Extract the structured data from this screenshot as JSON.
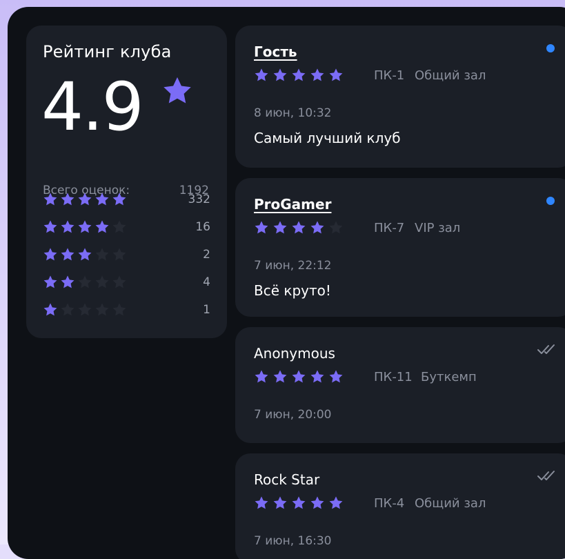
{
  "summary": {
    "title": "Рейтинг клуба",
    "score": "4.9",
    "total_label": "Всего оценок:",
    "total_value": "1192",
    "distribution": [
      {
        "stars": 5,
        "count": "332"
      },
      {
        "stars": 4,
        "count": "16"
      },
      {
        "stars": 3,
        "count": "2"
      },
      {
        "stars": 2,
        "count": "4"
      },
      {
        "stars": 1,
        "count": "1"
      }
    ]
  },
  "reviews": [
    {
      "name": "Гость",
      "underlined": true,
      "rating": 5,
      "pc": "ПК-1",
      "hall": "Общий зал",
      "date": "8 июн, 10:32",
      "text": "Самый лучший клуб",
      "status": "unread"
    },
    {
      "name": "ProGamer",
      "underlined": true,
      "rating": 4,
      "pc": "ПК-7",
      "hall": "VIP зал",
      "date": "7 июн, 22:12",
      "text": "Всё круто!",
      "status": "unread"
    },
    {
      "name": "Anonymous",
      "underlined": false,
      "rating": 5,
      "pc": "ПК-11",
      "hall": "Буткемп",
      "date": "7 июн, 20:00",
      "text": "",
      "status": "read"
    },
    {
      "name": "Rock Star",
      "underlined": false,
      "rating": 5,
      "pc": "ПК-4",
      "hall": "Общий зал",
      "date": "7 июн, 16:30",
      "text": "",
      "status": "read"
    }
  ],
  "colors": {
    "star_active": "#7b6cf6",
    "star_inactive": "#262a33",
    "unread_dot": "#2f86ff",
    "card_bg": "#1b1f27",
    "page_bg": "#0e1116"
  },
  "icons": {
    "star": "star-icon",
    "unread": "unread-dot-icon",
    "read": "double-check-icon"
  }
}
